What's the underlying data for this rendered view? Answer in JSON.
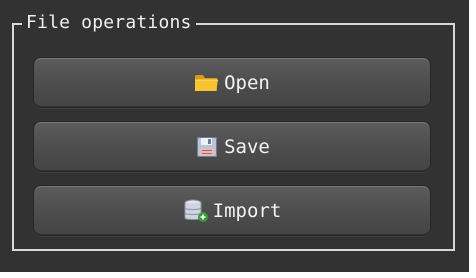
{
  "group": {
    "title": "File operations"
  },
  "buttons": [
    {
      "label": "Open",
      "icon": "folder-icon"
    },
    {
      "label": "Save",
      "icon": "floppy-disk-icon"
    },
    {
      "label": "Import",
      "icon": "database-import-icon"
    }
  ],
  "colors": {
    "panel_background": "#323232",
    "group_border": "#d8d8d8",
    "text": "#f2f2f2",
    "button_top": "#5c5c5c",
    "button_bottom": "#444444"
  }
}
